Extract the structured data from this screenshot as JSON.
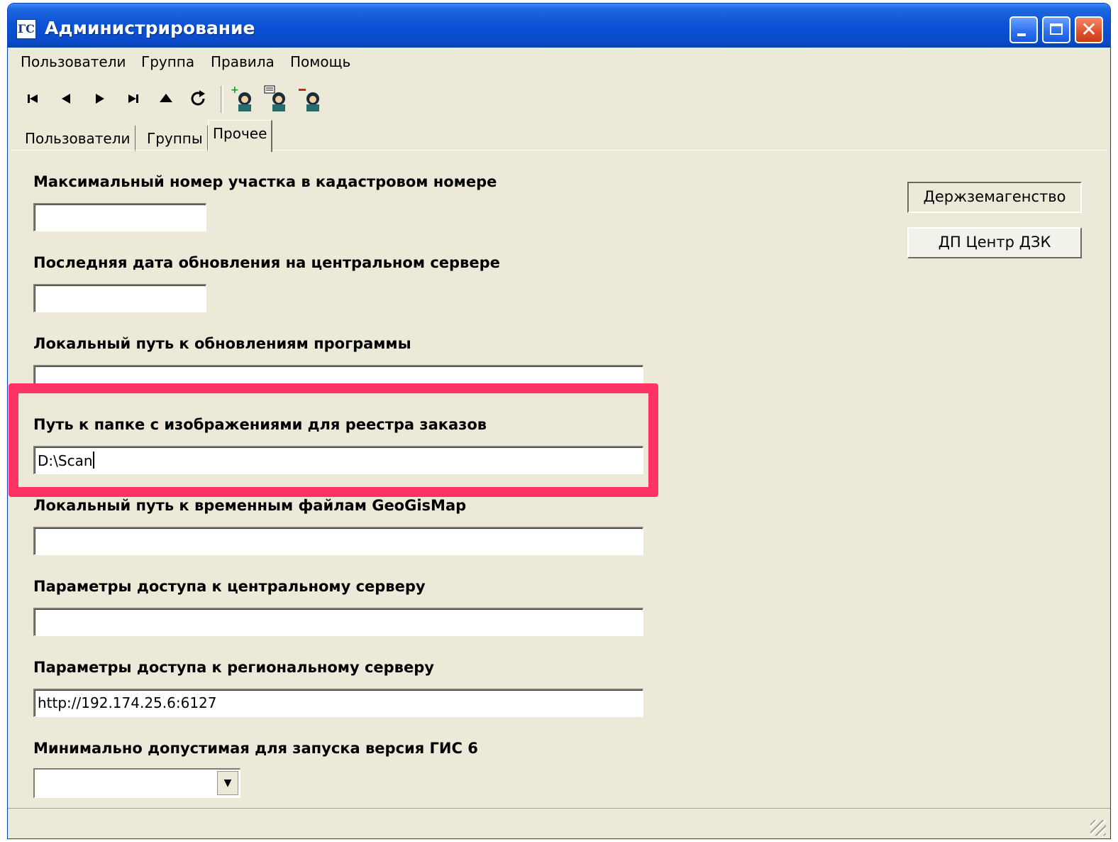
{
  "window": {
    "title": "Администрирование",
    "icon_text": "ГС"
  },
  "menu": [
    "Пользователи",
    "Группа",
    "Правила",
    "Помощь"
  ],
  "toolbar": {
    "nav_icons": [
      "first-record-icon",
      "prev-record-icon",
      "next-record-icon",
      "last-record-icon",
      "up-icon",
      "refresh-icon"
    ],
    "user_icons": [
      "add-user-icon",
      "edit-user-icon",
      "delete-user-icon"
    ]
  },
  "tabs": [
    {
      "label": "Пользователи",
      "active": false
    },
    {
      "label": "Группы",
      "active": false
    },
    {
      "label": "Прочее",
      "active": true
    }
  ],
  "fields": [
    {
      "label": "Максимальный номер участка в кадастровом номере",
      "value": ""
    },
    {
      "label": "Последняя дата обновления на центральном сервере",
      "value": ""
    },
    {
      "label": "Локальный путь к обновлениям программы",
      "value": ""
    },
    {
      "label": "Путь к папке с изображениями для реестра заказов",
      "value": "D:\\Scan"
    },
    {
      "label": "Локальный путь к временным файлам GeoGisMap",
      "value": ""
    },
    {
      "label": "Параметры доступа к центральному серверу",
      "value": ""
    },
    {
      "label": "Параметры доступа к региональному серверу",
      "value": "http://192.174.25.6:6127"
    },
    {
      "label": "Минимально допустимая для запуска версия ГИС 6",
      "value": ""
    }
  ],
  "side_buttons": [
    "Держземагенство",
    "ДП Центр ДЗК"
  ],
  "colors": {
    "highlight": "#ff3366",
    "window_bg": "#ece9d8",
    "titlebar": "#0a52d6"
  }
}
